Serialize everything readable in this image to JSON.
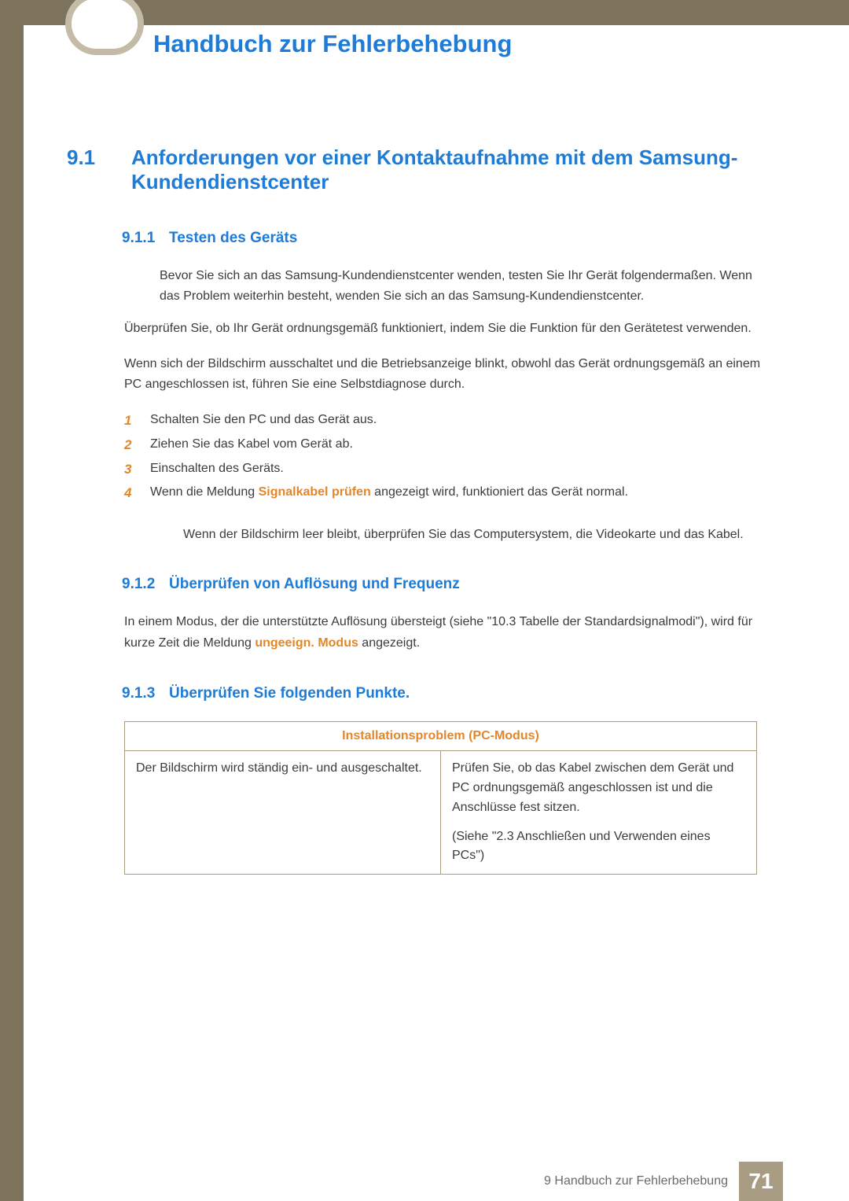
{
  "page_title": "Handbuch zur Fehlerbehebung",
  "section": {
    "num": "9.1",
    "title": "Anforderungen vor einer Kontaktaufnahme mit dem Samsung-Kundendienstcenter"
  },
  "sub1": {
    "num": "9.1.1",
    "title": "Testen des Geräts",
    "intro1": "Bevor Sie sich an das Samsung-Kundendienstcenter wenden, testen Sie Ihr Gerät folgendermaßen. Wenn das Problem weiterhin besteht, wenden Sie sich an das Samsung-Kundendienstcenter.",
    "para1": "Überprüfen Sie, ob Ihr Gerät ordnungsgemäß funktioniert, indem Sie die Funktion für den Gerätetest verwenden.",
    "para2": "Wenn sich der Bildschirm ausschaltet und die Betriebsanzeige blinkt, obwohl das Gerät ordnungsgemäß an einem PC angeschlossen ist, führen Sie eine Selbstdiagnose durch.",
    "steps": [
      {
        "n": "1",
        "t": "Schalten Sie den PC und das Gerät aus."
      },
      {
        "n": "2",
        "t": "Ziehen Sie das Kabel vom Gerät ab."
      },
      {
        "n": "3",
        "t": "Einschalten des Geräts."
      },
      {
        "n": "4",
        "t_before": "Wenn die Meldung ",
        "t_strong": "Signalkabel prüfen",
        "t_after": " angezeigt wird, funktioniert das Gerät normal."
      }
    ],
    "note": "Wenn der Bildschirm leer bleibt, überprüfen Sie das Computersystem, die Videokarte und das Kabel."
  },
  "sub2": {
    "num": "9.1.2",
    "title": "Überprüfen von Auflösung und Frequenz",
    "para_before": "In einem Modus, der die unterstützte Auflösung übersteigt (siehe \"10.3 Tabelle der Standardsignalmodi\"), wird für kurze Zeit die Meldung ",
    "para_strong": "ungeeign. Modus",
    "para_after": " angezeigt."
  },
  "sub3": {
    "num": "9.1.3",
    "title": "Überprüfen Sie folgenden Punkte.",
    "table_header": "Installationsproblem (PC-Modus)",
    "row": {
      "left": "Der Bildschirm wird ständig ein- und ausgeschaltet.",
      "right1": "Prüfen Sie, ob das Kabel zwischen dem Gerät und PC ordnungsgemäß angeschlossen ist und die Anschlüsse fest sitzen.",
      "right2": "(Siehe \"2.3 Anschließen und Verwenden eines PCs\")"
    }
  },
  "footer": {
    "text": "9 Handbuch zur Fehlerbehebung",
    "page": "71"
  }
}
